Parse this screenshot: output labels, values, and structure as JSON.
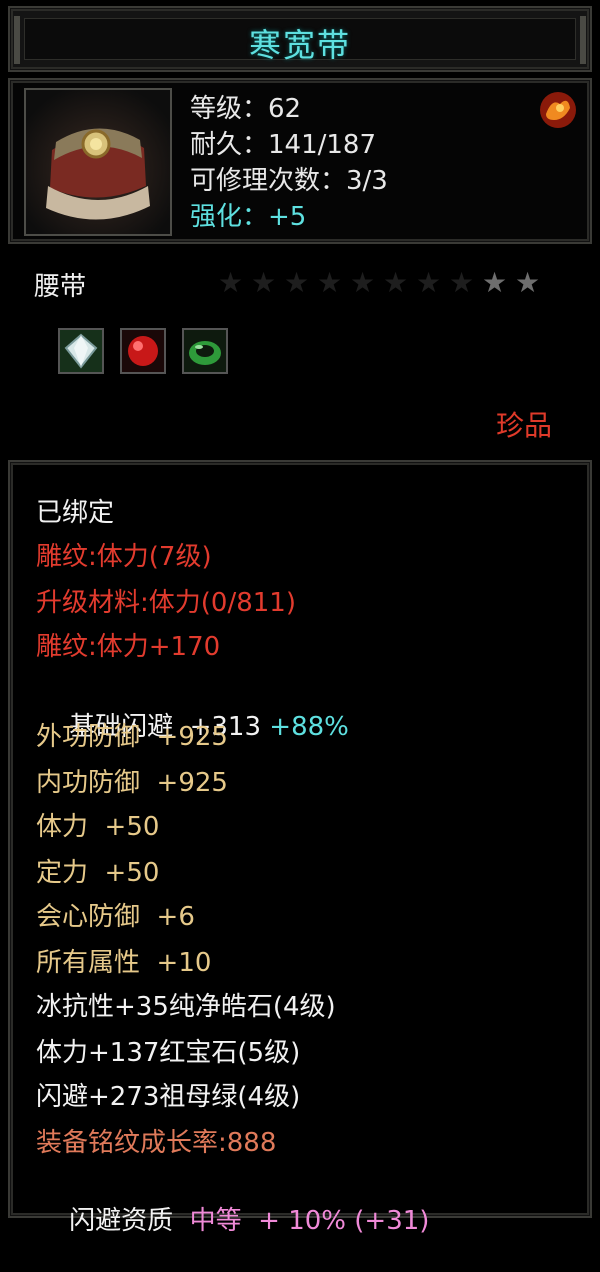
{
  "item": {
    "name": "寒宽带",
    "level_text": "等级：62",
    "durability_text": "耐久：141/187",
    "repair_text": "可修理次数：3/3",
    "enhance_text": "强化：+5",
    "type": "腰带",
    "rarity": "珍品",
    "stars_total": 10,
    "stars_lit": 2
  },
  "gems": [
    {
      "icon": "diamond-gem-icon",
      "color": "#cfe0e0"
    },
    {
      "icon": "ruby-gem-icon",
      "color": "#d42020"
    },
    {
      "icon": "emerald-gem-icon",
      "color": "#2ea03a"
    }
  ],
  "details": {
    "bound": "已绑定",
    "engrave": "雕纹:体力(7级)",
    "upgrade_material": "升级材料:体力(0/811)",
    "engrave_bonus": "雕纹:体力+170",
    "dodge_label": "基础闪避",
    "dodge_value": "+313",
    "dodge_pct": "+88%",
    "ext_def": "外功防御  +925",
    "int_def": "内功防御  +925",
    "stamina": "体力  +50",
    "focus": "定力  +50",
    "crit_def": "会心防御  +6",
    "all_attr": "所有属性  +10",
    "gem1": "冰抗性+35纯净皓石(4级)",
    "gem2": "体力+137红宝石(5级)",
    "gem3": "闪避+273祖母绿(4级)",
    "growth": "装备铭纹成长率:888",
    "aptitude_label": "闪避资质",
    "aptitude_grade": "中等",
    "aptitude_bonus": "+ 10% (+31)"
  },
  "colors": {
    "title": "#5ee0e0",
    "rare": "#e03a2a",
    "engrave": "#e23b2e",
    "attr": "#e6c98a"
  }
}
